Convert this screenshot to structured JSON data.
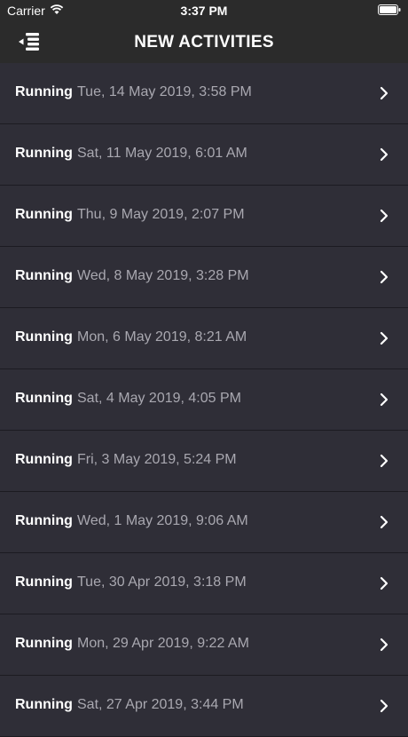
{
  "status": {
    "carrier": "Carrier",
    "time": "3:37 PM"
  },
  "nav": {
    "title": "NEW ACTIVITIES"
  },
  "activities": [
    {
      "type": "Running",
      "date": "Tue, 14 May 2019, 3:58 PM"
    },
    {
      "type": "Running",
      "date": "Sat, 11 May 2019, 6:01 AM"
    },
    {
      "type": "Running",
      "date": "Thu, 9 May 2019, 2:07 PM"
    },
    {
      "type": "Running",
      "date": "Wed, 8 May 2019, 3:28 PM"
    },
    {
      "type": "Running",
      "date": "Mon, 6 May 2019, 8:21 AM"
    },
    {
      "type": "Running",
      "date": "Sat, 4 May 2019, 4:05 PM"
    },
    {
      "type": "Running",
      "date": "Fri, 3 May 2019, 5:24 PM"
    },
    {
      "type": "Running",
      "date": "Wed, 1 May 2019, 9:06 AM"
    },
    {
      "type": "Running",
      "date": "Tue, 30 Apr 2019, 3:18 PM"
    },
    {
      "type": "Running",
      "date": "Mon, 29 Apr 2019, 9:22 AM"
    },
    {
      "type": "Running",
      "date": "Sat, 27 Apr 2019, 3:44 PM"
    }
  ],
  "icons": {
    "menu": "menu-collapse-icon",
    "row": "chevron-right-icon"
  }
}
